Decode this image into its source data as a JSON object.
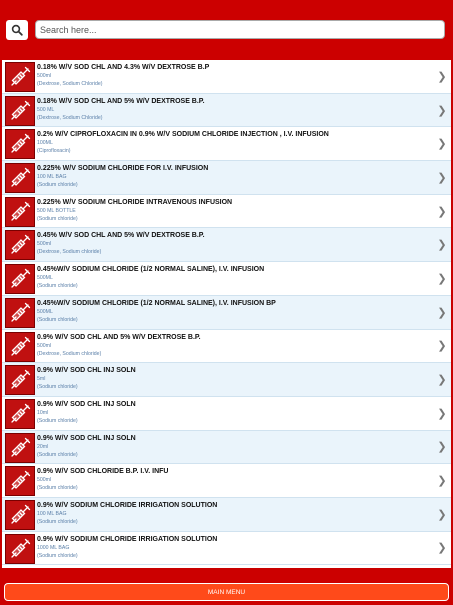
{
  "search": {
    "placeholder": "Search here..."
  },
  "items": [
    {
      "title": "0.18% W/V SOD CHL AND 4.3% W/V DEXTROSE B.P",
      "volume": "500ml",
      "ingredients": "(Dextrose, Sodium Chloride)"
    },
    {
      "title": "0.18% W/V SOD CHL AND 5% W/V DEXTROSE B.P.",
      "volume": "500 ML",
      "ingredients": "(Dextrose, Sodium Chloride)"
    },
    {
      "title": "0.2% W/V CIPROFLOXACIN IN 0.9% W/V SODIUM CHLORIDE INJECTION , I.V. INFUSION",
      "volume": "100ML",
      "ingredients": "(Ciprofloxacin)"
    },
    {
      "title": "0.225% W/V SODIUM CHLORIDE FOR I.V. INFUSION",
      "volume": "100 ML BAG",
      "ingredients": "(Sodium chloride)"
    },
    {
      "title": "0.225% W/V SODIUM CHLORIDE INTRAVENOUS INFUSION",
      "volume": "500 ML BOTTLE",
      "ingredients": "(Sodium chloride)"
    },
    {
      "title": "0.45% W/V SOD CHL AND 5% W/V DEXTROSE B.P.",
      "volume": "500ml",
      "ingredients": "(Dextrose, Sodium chloride)"
    },
    {
      "title": "0.45%W/V SODIUM CHLORIDE (1/2 NORMAL SALINE), I.V. INFUSION",
      "volume": "500ML",
      "ingredients": "(Sodium chloride)"
    },
    {
      "title": "0.45%W/V SODIUM CHLORIDE (1/2 NORMAL SALINE), I.V. INFUSION BP",
      "volume": "500ML",
      "ingredients": "(Sodium chloride)"
    },
    {
      "title": "0.9% W/V SOD CHL AND 5% W/V DEXTROSE B.P.",
      "volume": "500ml",
      "ingredients": "(Dextrose, Sodium chloride)"
    },
    {
      "title": "0.9% W/V SOD CHL INJ SOLN",
      "volume": "5ml",
      "ingredients": "(Sodium chloride)"
    },
    {
      "title": "0.9% W/V SOD CHL INJ SOLN",
      "volume": "10ml",
      "ingredients": "(Sodium chloride)"
    },
    {
      "title": "0.9% W/V SOD CHL INJ SOLN",
      "volume": "20ml",
      "ingredients": "(Sodium chloride)"
    },
    {
      "title": "0.9% W/V SOD CHLORIDE B.P. I.V. INFU",
      "volume": "500ml",
      "ingredients": "(Sodium chloride)"
    },
    {
      "title": "0.9% W/V SODIUM CHLORIDE IRRIGATION SOLUTION",
      "volume": "100 ML BAG",
      "ingredients": "(Sodium chloride)"
    },
    {
      "title": "0.9% W/V SODIUM CHLORIDE IRRIGATION SOLUTION",
      "volume": "1000 ML BAG",
      "ingredients": "(Sodium chloride)"
    }
  ],
  "footer": {
    "menu_label": "MAIN MENU"
  },
  "colors": {
    "brand": "#cc0000",
    "menu_button": "#ff4a1a",
    "row_alt": "#eaf4fb",
    "subtext": "#5a7fa8"
  }
}
